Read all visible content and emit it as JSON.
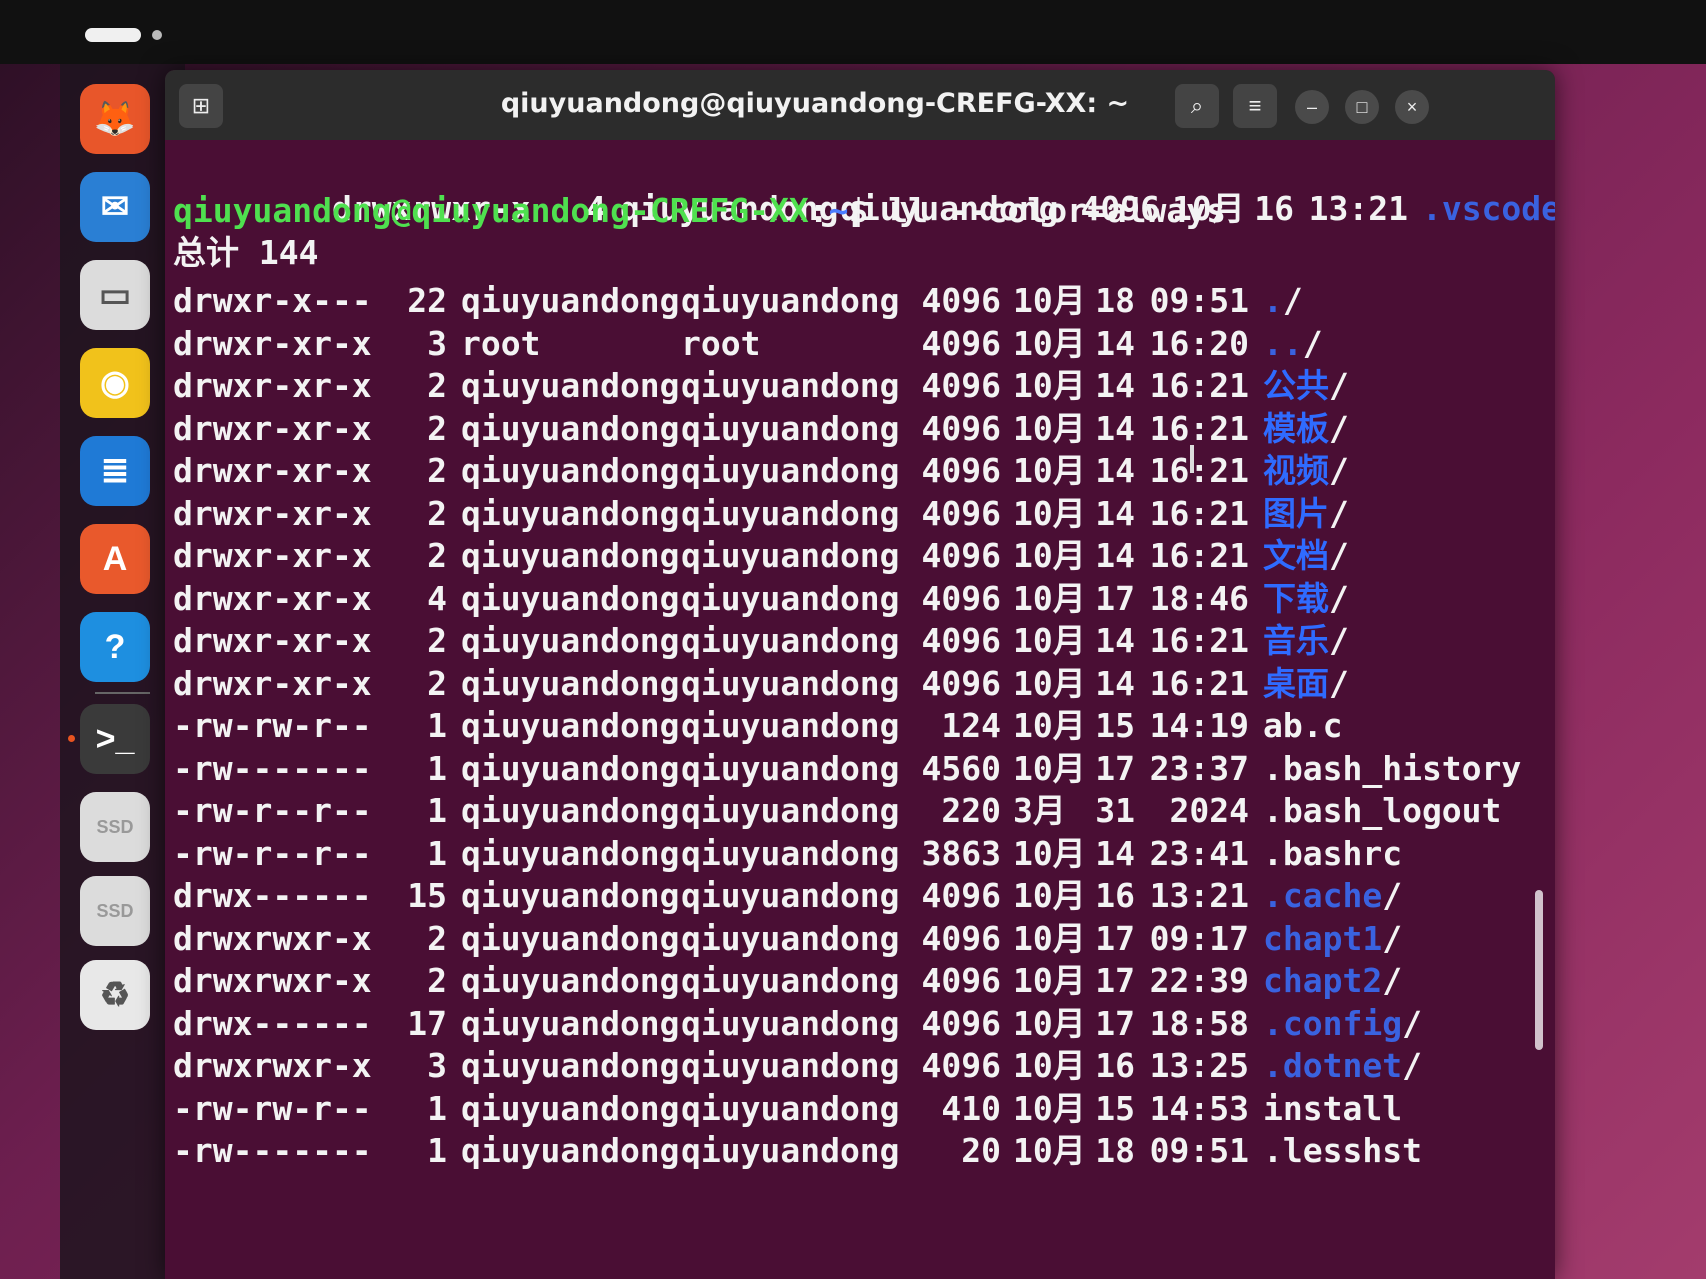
{
  "window": {
    "title": "qiuyuandong@qiuyuandong-CREFG-XX: ~"
  },
  "dock": {
    "apps": [
      {
        "name": "firefox-icon",
        "glyph": "🦊",
        "color": "#e8562a"
      },
      {
        "name": "thunderbird-icon",
        "glyph": "✉",
        "color": "#2a7fd4"
      },
      {
        "name": "files-icon",
        "glyph": "▭",
        "color": "#dcdcdc"
      },
      {
        "name": "rhythmbox-icon",
        "glyph": "◉",
        "color": "#f1c21b"
      },
      {
        "name": "writer-icon",
        "glyph": "≣",
        "color": "#1f7ad6"
      },
      {
        "name": "app-center-icon",
        "glyph": "A",
        "color": "#e9592c"
      },
      {
        "name": "help-icon",
        "glyph": "?",
        "color": "#1e8fe0"
      },
      {
        "name": "terminal-icon",
        "glyph": ">_",
        "color": "#3a3a3a"
      },
      {
        "name": "ssd-drive-icon",
        "glyph": "SSD",
        "color": "#dcdcdc"
      },
      {
        "name": "ssd-drive-2-icon",
        "glyph": "SSD",
        "color": "#dcdcdc"
      },
      {
        "name": "trash-icon",
        "glyph": "♻",
        "color": "#e8e8e8"
      }
    ]
  },
  "terminal": {
    "prev_line": {
      "perm": "drwxrwxr-x",
      "links": "4",
      "user": "qiuyuandong",
      "group": "qiuyuandong",
      "size": "4096",
      "mon": "10月",
      "day": "16",
      "time": "13:21",
      "name": ".vscode",
      "slash": "/"
    },
    "prompt": {
      "user_host": "qiuyuandong@qiuyuandong-CREFG-XX",
      "colon": ":",
      "path": "~",
      "symbol": "$",
      "command": " ll --color=always"
    },
    "total": "总计 144",
    "rows": [
      {
        "perm": "drwxr-x---",
        "links": "22",
        "user": "qiuyuandong",
        "group": "qiuyuandong",
        "size": "4096",
        "mon": "10月",
        "day": "18",
        "time": "09:51",
        "name": ".",
        "slash": "/",
        "cls": "dir-hidden"
      },
      {
        "perm": "drwxr-xr-x",
        "links": "3",
        "user": "root",
        "group": "root",
        "size": "4096",
        "mon": "10月",
        "day": "14",
        "time": "16:20",
        "name": "..",
        "slash": "/",
        "cls": "dir-hidden"
      },
      {
        "perm": "drwxr-xr-x",
        "links": "2",
        "user": "qiuyuandong",
        "group": "qiuyuandong",
        "size": "4096",
        "mon": "10月",
        "day": "14",
        "time": "16:21",
        "name": "公共",
        "slash": "/",
        "cls": "dir-blue"
      },
      {
        "perm": "drwxr-xr-x",
        "links": "2",
        "user": "qiuyuandong",
        "group": "qiuyuandong",
        "size": "4096",
        "mon": "10月",
        "day": "14",
        "time": "16:21",
        "name": "模板",
        "slash": "/",
        "cls": "dir-blue"
      },
      {
        "perm": "drwxr-xr-x",
        "links": "2",
        "user": "qiuyuandong",
        "group": "qiuyuandong",
        "size": "4096",
        "mon": "10月",
        "day": "14",
        "time": "16:21",
        "name": "视频",
        "slash": "/",
        "cls": "dir-blue"
      },
      {
        "perm": "drwxr-xr-x",
        "links": "2",
        "user": "qiuyuandong",
        "group": "qiuyuandong",
        "size": "4096",
        "mon": "10月",
        "day": "14",
        "time": "16:21",
        "name": "图片",
        "slash": "/",
        "cls": "dir-blue"
      },
      {
        "perm": "drwxr-xr-x",
        "links": "2",
        "user": "qiuyuandong",
        "group": "qiuyuandong",
        "size": "4096",
        "mon": "10月",
        "day": "14",
        "time": "16:21",
        "name": "文档",
        "slash": "/",
        "cls": "dir-blue"
      },
      {
        "perm": "drwxr-xr-x",
        "links": "4",
        "user": "qiuyuandong",
        "group": "qiuyuandong",
        "size": "4096",
        "mon": "10月",
        "day": "17",
        "time": "18:46",
        "name": "下载",
        "slash": "/",
        "cls": "dir-blue"
      },
      {
        "perm": "drwxr-xr-x",
        "links": "2",
        "user": "qiuyuandong",
        "group": "qiuyuandong",
        "size": "4096",
        "mon": "10月",
        "day": "14",
        "time": "16:21",
        "name": "音乐",
        "slash": "/",
        "cls": "dir-blue"
      },
      {
        "perm": "drwxr-xr-x",
        "links": "2",
        "user": "qiuyuandong",
        "group": "qiuyuandong",
        "size": "4096",
        "mon": "10月",
        "day": "14",
        "time": "16:21",
        "name": "桌面",
        "slash": "/",
        "cls": "dir-blue"
      },
      {
        "perm": "-rw-rw-r--",
        "links": "1",
        "user": "qiuyuandong",
        "group": "qiuyuandong",
        "size": "124",
        "mon": "10月",
        "day": "15",
        "time": "14:19",
        "name": "ab.c",
        "slash": "",
        "cls": ""
      },
      {
        "perm": "-rw-------",
        "links": "1",
        "user": "qiuyuandong",
        "group": "qiuyuandong",
        "size": "4560",
        "mon": "10月",
        "day": "17",
        "time": "23:37",
        "name": ".bash_history",
        "slash": "",
        "cls": ""
      },
      {
        "perm": "-rw-r--r--",
        "links": "1",
        "user": "qiuyuandong",
        "group": "qiuyuandong",
        "size": "220",
        "mon": "3月",
        "day": "31",
        "time": "2024",
        "name": ".bash_logout",
        "slash": "",
        "cls": ""
      },
      {
        "perm": "-rw-r--r--",
        "links": "1",
        "user": "qiuyuandong",
        "group": "qiuyuandong",
        "size": "3863",
        "mon": "10月",
        "day": "14",
        "time": "23:41",
        "name": ".bashrc",
        "slash": "",
        "cls": ""
      },
      {
        "perm": "drwx------",
        "links": "15",
        "user": "qiuyuandong",
        "group": "qiuyuandong",
        "size": "4096",
        "mon": "10月",
        "day": "16",
        "time": "13:21",
        "name": ".cache",
        "slash": "/",
        "cls": "dir-hidden"
      },
      {
        "perm": "drwxrwxr-x",
        "links": "2",
        "user": "qiuyuandong",
        "group": "qiuyuandong",
        "size": "4096",
        "mon": "10月",
        "day": "17",
        "time": "09:17",
        "name": "chapt1",
        "slash": "/",
        "cls": "dir-hidden"
      },
      {
        "perm": "drwxrwxr-x",
        "links": "2",
        "user": "qiuyuandong",
        "group": "qiuyuandong",
        "size": "4096",
        "mon": "10月",
        "day": "17",
        "time": "22:39",
        "name": "chapt2",
        "slash": "/",
        "cls": "dir-hidden"
      },
      {
        "perm": "drwx------",
        "links": "17",
        "user": "qiuyuandong",
        "group": "qiuyuandong",
        "size": "4096",
        "mon": "10月",
        "day": "17",
        "time": "18:58",
        "name": ".config",
        "slash": "/",
        "cls": "dir-hidden"
      },
      {
        "perm": "drwxrwxr-x",
        "links": "3",
        "user": "qiuyuandong",
        "group": "qiuyuandong",
        "size": "4096",
        "mon": "10月",
        "day": "16",
        "time": "13:25",
        "name": ".dotnet",
        "slash": "/",
        "cls": "dir-hidden"
      },
      {
        "perm": "-rw-rw-r--",
        "links": "1",
        "user": "qiuyuandong",
        "group": "qiuyuandong",
        "size": "410",
        "mon": "10月",
        "day": "15",
        "time": "14:53",
        "name": "install",
        "slash": "",
        "cls": ""
      },
      {
        "perm": "-rw-------",
        "links": "1",
        "user": "qiuyuandong",
        "group": "qiuyuandong",
        "size": "20",
        "mon": "10月",
        "day": "18",
        "time": "09:51",
        "name": ".lesshst",
        "slash": "",
        "cls": ""
      }
    ]
  }
}
